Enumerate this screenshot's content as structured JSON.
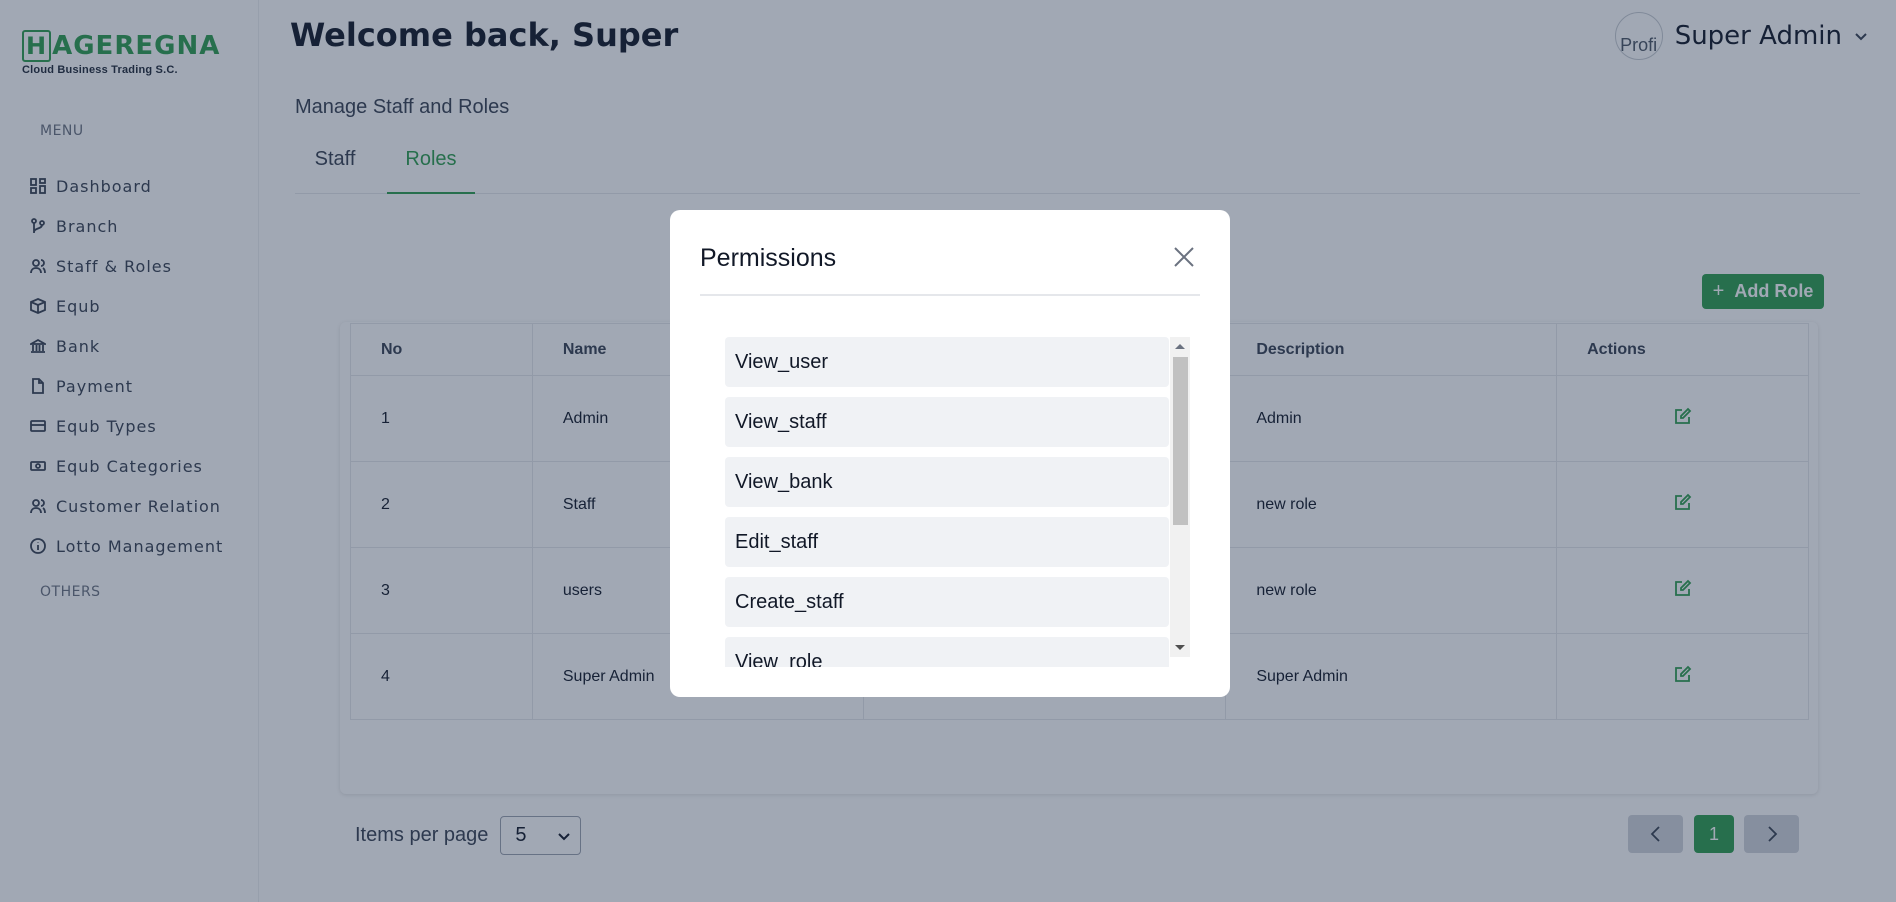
{
  "sidebar": {
    "logo_text": "AGEREGNA",
    "logo_letter": "H",
    "logo_sub": "Cloud  Business Trading S.C.",
    "menu_title": "MENU",
    "others_title": "OTHERS",
    "items": [
      {
        "label": "Dashboard",
        "icon": "grid-icon"
      },
      {
        "label": "Branch",
        "icon": "branch-icon"
      },
      {
        "label": "Staff & Roles",
        "icon": "users-icon"
      },
      {
        "label": "Equb",
        "icon": "box-icon"
      },
      {
        "label": "Bank",
        "icon": "bank-icon"
      },
      {
        "label": "Payment",
        "icon": "file-icon"
      },
      {
        "label": "Equb Types",
        "icon": "card-icon"
      },
      {
        "label": "Equb Categories",
        "icon": "banknote-icon"
      },
      {
        "label": "Customer Relation",
        "icon": "users-icon"
      },
      {
        "label": "Lotto Management",
        "icon": "info-icon"
      }
    ]
  },
  "header": {
    "welcome": "Welcome back, Super",
    "avatar_alt": "Profi",
    "user_name": "Super Admin"
  },
  "main": {
    "section_title": "Manage Staff and Roles",
    "tabs": [
      {
        "label": "Staff"
      },
      {
        "label": "Roles",
        "active": true
      }
    ],
    "add_role_label": "Add Role",
    "table": {
      "headers": [
        "No",
        "Name",
        "",
        "Description",
        "Actions"
      ],
      "rows": [
        {
          "no": "1",
          "name": "Admin",
          "description": "Admin"
        },
        {
          "no": "2",
          "name": "Staff",
          "description": "new role"
        },
        {
          "no": "3",
          "name": "users",
          "description": "new role"
        },
        {
          "no": "4",
          "name": "Super Admin",
          "description": "Super Admin"
        }
      ]
    },
    "items_per_page_label": "Items per page",
    "items_per_page_value": "5",
    "current_page": "1"
  },
  "modal": {
    "title": "Permissions",
    "permissions": [
      "View_user",
      "View_staff",
      "View_bank",
      "Edit_staff",
      "Create_staff",
      "View_role"
    ]
  },
  "colors": {
    "accent": "#2e9e4f",
    "overlay": "rgba(30,48,76,0.42)"
  }
}
